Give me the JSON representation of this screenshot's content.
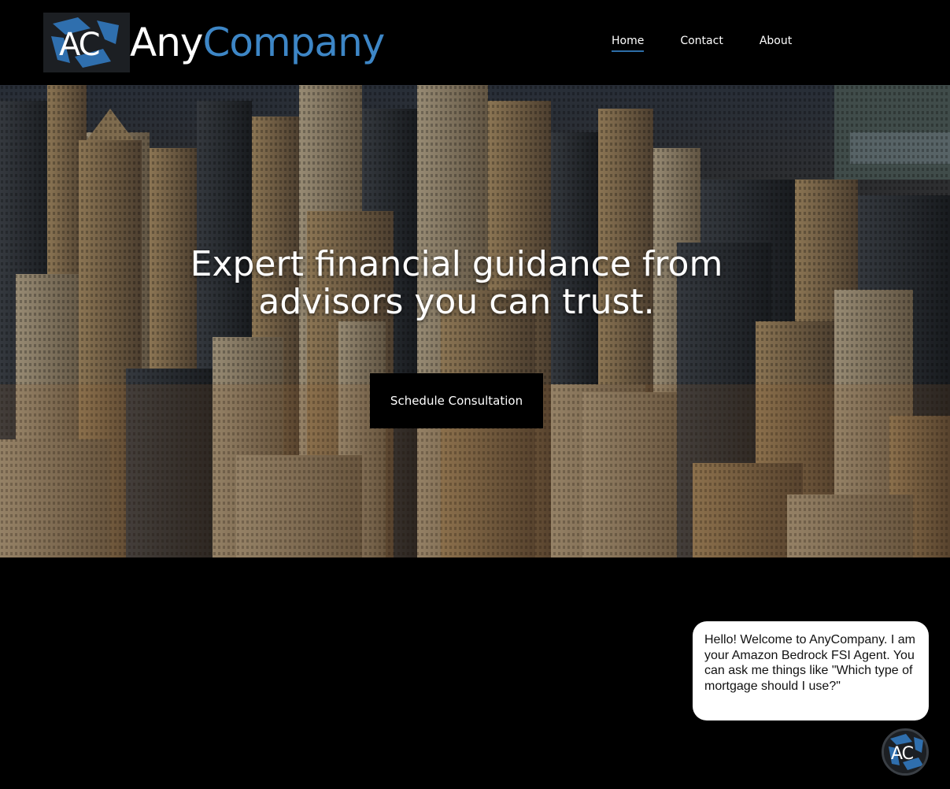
{
  "header": {
    "logo_text": "AC",
    "brand_any": "Any",
    "brand_company": "Company"
  },
  "nav": {
    "items": [
      {
        "label": "Home",
        "active": true
      },
      {
        "label": "Contact",
        "active": false
      },
      {
        "label": "About",
        "active": false
      }
    ]
  },
  "hero": {
    "title_line1": "Expert financial guidance from",
    "title_line2": "advisors you can trust.",
    "cta_label": "Schedule Consultation"
  },
  "chat": {
    "message": "Hello! Welcome to AnyCompany. I am your Amazon Bedrock FSI Agent. You can ask me things like \"Which type of mortgage should I use?\"",
    "avatar_text": "AC"
  },
  "colors": {
    "accent": "#3d86c6",
    "background": "#000000",
    "nav_underline": "#2d6ea8"
  }
}
